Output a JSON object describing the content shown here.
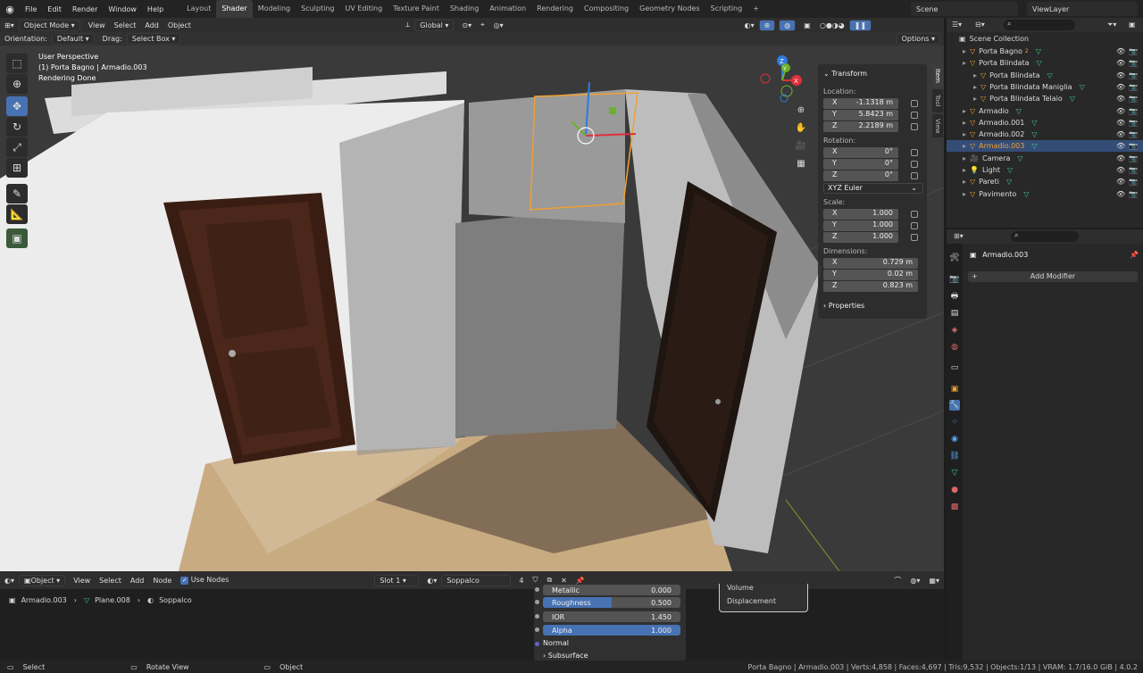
{
  "topbar": {
    "menus": [
      "File",
      "Edit",
      "Render",
      "Window",
      "Help"
    ],
    "workspaces": [
      "Layout",
      "Shader",
      "Modeling",
      "Sculpting",
      "UV Editing",
      "Texture Paint",
      "Shading",
      "Animation",
      "Rendering",
      "Compositing",
      "Geometry Nodes",
      "Scripting"
    ],
    "active_workspace": "Shader",
    "add": "+",
    "scene": "Scene",
    "view_layer": "ViewLayer"
  },
  "viewport": {
    "mode": "Object Mode",
    "menus": [
      "View",
      "Select",
      "Add",
      "Object"
    ],
    "transform_orientation": "Global",
    "orientation_label": "Orientation:",
    "orientation_value": "Default",
    "drag_label": "Drag:",
    "drag_value": "Select Box",
    "options": "Options",
    "overlay": {
      "line1": "User Perspective",
      "line2": "(1) Porta Bagno | Armadio.003",
      "line3": "Rendering Done"
    },
    "gizmo": {
      "x": "X",
      "y": "Y",
      "z": "Z"
    }
  },
  "npanel": {
    "tabs": [
      "Item",
      "Tool",
      "View"
    ],
    "transform": "Transform",
    "location_label": "Location:",
    "location": [
      {
        "axis": "X",
        "value": "-1.1318 m"
      },
      {
        "axis": "Y",
        "value": "5.8423 m"
      },
      {
        "axis": "Z",
        "value": "2.2189 m"
      }
    ],
    "rotation_label": "Rotation:",
    "rotation": [
      {
        "axis": "X",
        "value": "0°"
      },
      {
        "axis": "Y",
        "value": "0°"
      },
      {
        "axis": "Z",
        "value": "0°"
      }
    ],
    "rotation_mode": "XYZ Euler",
    "scale_label": "Scale:",
    "scale": [
      {
        "axis": "X",
        "value": "1.000"
      },
      {
        "axis": "Y",
        "value": "1.000"
      },
      {
        "axis": "Z",
        "value": "1.000"
      }
    ],
    "dimensions_label": "Dimensions:",
    "dimensions": [
      {
        "axis": "X",
        "value": "0.729 m"
      },
      {
        "axis": "Y",
        "value": "0.02 m"
      },
      {
        "axis": "Z",
        "value": "0.823 m"
      }
    ],
    "properties": "Properties"
  },
  "outliner": {
    "root": "Scene Collection",
    "items": [
      {
        "name": "Porta Bagno",
        "badge": "2",
        "level": 0
      },
      {
        "name": "Porta Blindata",
        "level": 0
      },
      {
        "name": "Porta Blindata",
        "level": 1
      },
      {
        "name": "Porta Blindata Maniglia",
        "level": 1
      },
      {
        "name": "Porta Blindata Telaio",
        "level": 1
      },
      {
        "name": "Armadio",
        "level": 0
      },
      {
        "name": "Armadio.001",
        "level": 0
      },
      {
        "name": "Armadio.002",
        "level": 0
      },
      {
        "name": "Armadio.003",
        "level": 0,
        "selected": true
      },
      {
        "name": "Camera",
        "level": 0
      },
      {
        "name": "Light",
        "level": 0
      },
      {
        "name": "Pareti",
        "level": 0
      },
      {
        "name": "Pavimento",
        "level": 0
      }
    ]
  },
  "properties": {
    "object": "Armadio.003",
    "add_modifier": "Add Modifier"
  },
  "node_editor": {
    "mode": "Object",
    "menus": [
      "View",
      "Select",
      "Add",
      "Node"
    ],
    "use_nodes": "Use Nodes",
    "slot": "Slot 1",
    "material": "Soppalco",
    "users": "4",
    "breadcrumb": [
      "Armadio.003",
      "Plane.008",
      "Soppalco"
    ],
    "bsdf": [
      {
        "label": "Metallic",
        "value": "0.000"
      },
      {
        "label": "Roughness",
        "value": "0.500",
        "highlight": true
      },
      {
        "label": "IOR",
        "value": "1.450"
      },
      {
        "label": "Alpha",
        "value": "1.000",
        "highlight": true
      }
    ],
    "normal": "Normal",
    "subsurface": "Subsurface",
    "output": {
      "volume": "Volume",
      "displacement": "Displacement"
    }
  },
  "status": {
    "select": "Select",
    "rotate": "Rotate View",
    "object": "Object",
    "stats": "Porta Bagno | Armadio.003 | Verts:4,858 | Faces:4,697 | Tris:9,532 | Objects:1/13 | VRAM: 1.7/16.0 GiB | 4.0.2"
  },
  "colors": {
    "accent": "#4772b3",
    "selected_outline": "#f0a030",
    "bg": "#1d1d1d"
  }
}
